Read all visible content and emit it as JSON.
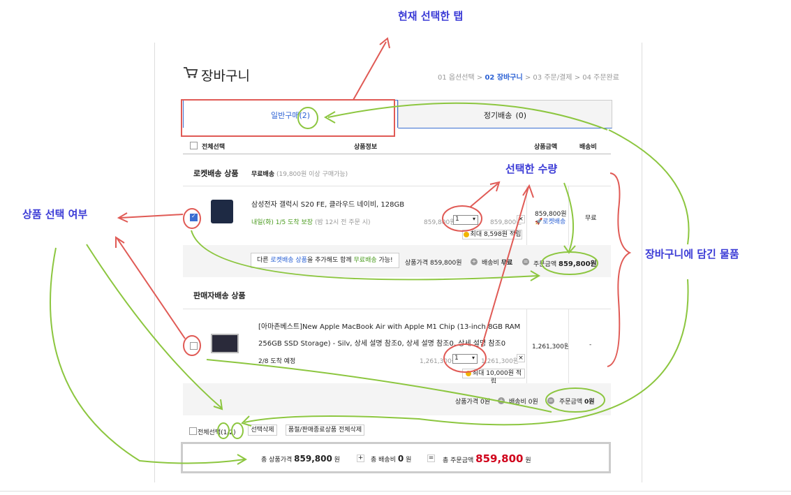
{
  "header": {
    "title": "장바구니",
    "steps": [
      {
        "label": "01 옵션선택",
        "active": false
      },
      {
        "label": "02 장바구니",
        "active": true
      },
      {
        "label": "03 주문/결제",
        "active": false
      },
      {
        "label": "04 주문완료",
        "active": false
      }
    ]
  },
  "tabs": [
    {
      "label": "일반구매",
      "count": "(2)",
      "active": true
    },
    {
      "label": "정기배송",
      "count": "(0)",
      "active": false
    }
  ],
  "table_header": {
    "select_all": "전체선택",
    "product_info": "상품정보",
    "product_price": "상품금액",
    "shipping_fee": "배송비"
  },
  "rocket_section": {
    "title": "로켓배송 상품",
    "free_ship_label": "무료배송",
    "free_ship_note": "(19,800원 이상 구매가능)",
    "item": {
      "name": "삼성전자 갤럭시 S20 FE, 클라우드 네이비, 128GB",
      "arrival": "내일(화) 1/5 도착 보장",
      "arrival_note": "(밤 12시 전 주문 시)",
      "unit_price": "859,800원",
      "qty": "1",
      "line_price": "859,800원",
      "reward": "최대 8,598원 적립",
      "col_price": "859,800원",
      "col_badge": "로켓배송",
      "col_ship": "무료",
      "checked": true
    },
    "summary": {
      "notice_pre": "다른 ",
      "notice_link": "로켓배송 상품",
      "notice_mid": "을 추가해도 함께 ",
      "notice_free": "무료배송",
      "notice_post": " 가능!",
      "price_label": "상품가격",
      "price": "859,800원",
      "ship_label": "배송비",
      "ship": "무료",
      "total_label": "주문금액",
      "total": "859,800원"
    }
  },
  "seller_section": {
    "title": "판매자배송 상품",
    "item": {
      "name_line1": "[아마존베스트]New Apple MacBook Air with Apple M1 Chip (13-inch 8GB RAM",
      "name_line2": "256GB SSD Storage) - Silv, 상세 설명 참조0, 상세 설명 참조0, 상세 설명 참조0",
      "arrival": "2/8 도착 예정",
      "unit_price": "1,261,300원",
      "qty": "1",
      "line_price": "1,261,300원",
      "reward": "최대 10,000원 적립",
      "col_price": "1,261,300원",
      "col_ship": "-",
      "checked": false
    },
    "summary": {
      "price_label": "상품가격",
      "price": "0원",
      "ship_label": "배송비",
      "ship": "0원",
      "total_label": "주문금액",
      "total": "0원"
    }
  },
  "bottom_bar": {
    "select_all": "전체선택",
    "count_selected": "1",
    "count_total": "2",
    "delete_selected": "선택삭제",
    "delete_soldout": "품절/판매종료상품 전체삭제"
  },
  "grand_total": {
    "price_label": "총 상품가격",
    "price": "859,800",
    "won1": "원",
    "ship_label": "총 배송비",
    "ship": "0",
    "won2": "원",
    "total_label": "총 주문금액",
    "total": "859,800",
    "won3": "원"
  },
  "annotations": {
    "current_tab": "현재 선택한 탭",
    "selected_qty": "선택한 수량",
    "select_status": "상품 선택 여부",
    "cart_items": "장바구니에 담긴 물품"
  },
  "colors": {
    "annotation_text": "#3b3bd6",
    "red_marker": "#e05a55",
    "green_marker": "#8cc63f",
    "accent_blue": "#2b61d4",
    "price_red": "#d0021b"
  }
}
